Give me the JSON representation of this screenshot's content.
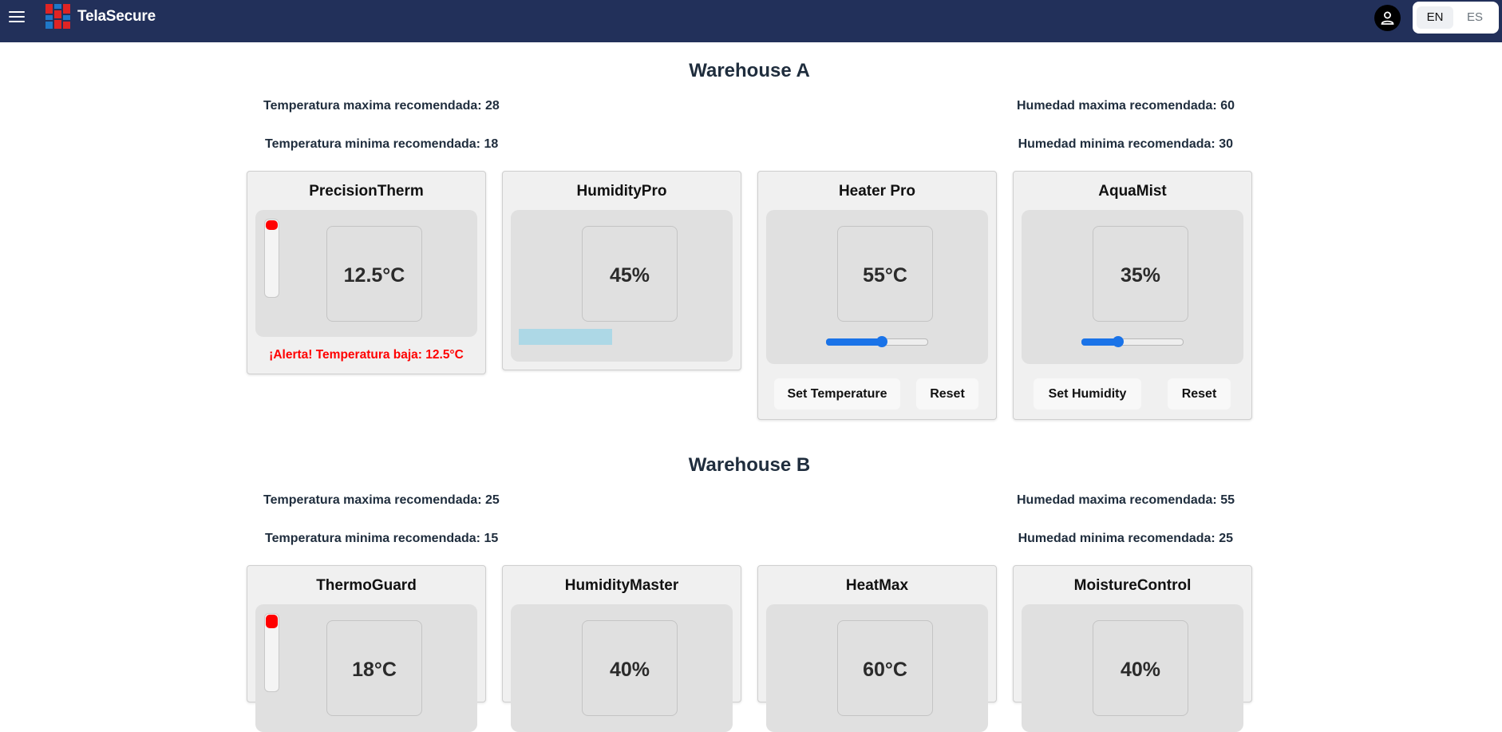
{
  "header": {
    "brand": "TelaSecure",
    "languages": [
      "EN",
      "ES"
    ],
    "active_language": "EN"
  },
  "warehouses": [
    {
      "title": "Warehouse A",
      "temp_max": "Temperatura maxima recomendada: 28",
      "temp_min": "Temperatura minima recomendada: 18",
      "hum_max": "Humedad maxima recomendada: 60",
      "hum_min": "Humedad minima recomendada: 30",
      "devices": [
        {
          "name": "PrecisionTherm",
          "value": "12.5°C",
          "alert": "¡Alerta! Temperatura baja: 12.5°C"
        },
        {
          "name": "HumidityPro",
          "value": "45%",
          "level": 0.45
        },
        {
          "name": "Heater Pro",
          "value": "55°C",
          "slider": 0.55,
          "button": "Set Temperature",
          "reset": "Reset"
        },
        {
          "name": "AquaMist",
          "value": "35%",
          "slider": 0.35,
          "button": "Set Humidity",
          "reset": "Reset"
        }
      ]
    },
    {
      "title": "Warehouse B",
      "temp_max": "Temperatura maxima recomendada: 25",
      "temp_min": "Temperatura minima recomendada: 15",
      "hum_max": "Humedad maxima recomendada: 55",
      "hum_min": "Humedad minima recomendada: 25",
      "devices": [
        {
          "name": "ThermoGuard",
          "value": "18°C"
        },
        {
          "name": "HumidityMaster",
          "value": "40%"
        },
        {
          "name": "HeatMax",
          "value": "60°C"
        },
        {
          "name": "MoistureControl",
          "value": "40%"
        }
      ]
    }
  ],
  "colors": {
    "header_bg": "#22305a",
    "alert": "#ff0000",
    "slider": "#1a73e8",
    "humidity_bar": "#add8e6"
  },
  "icons": [
    "menu-icon",
    "logo-icon",
    "user-icon"
  ]
}
